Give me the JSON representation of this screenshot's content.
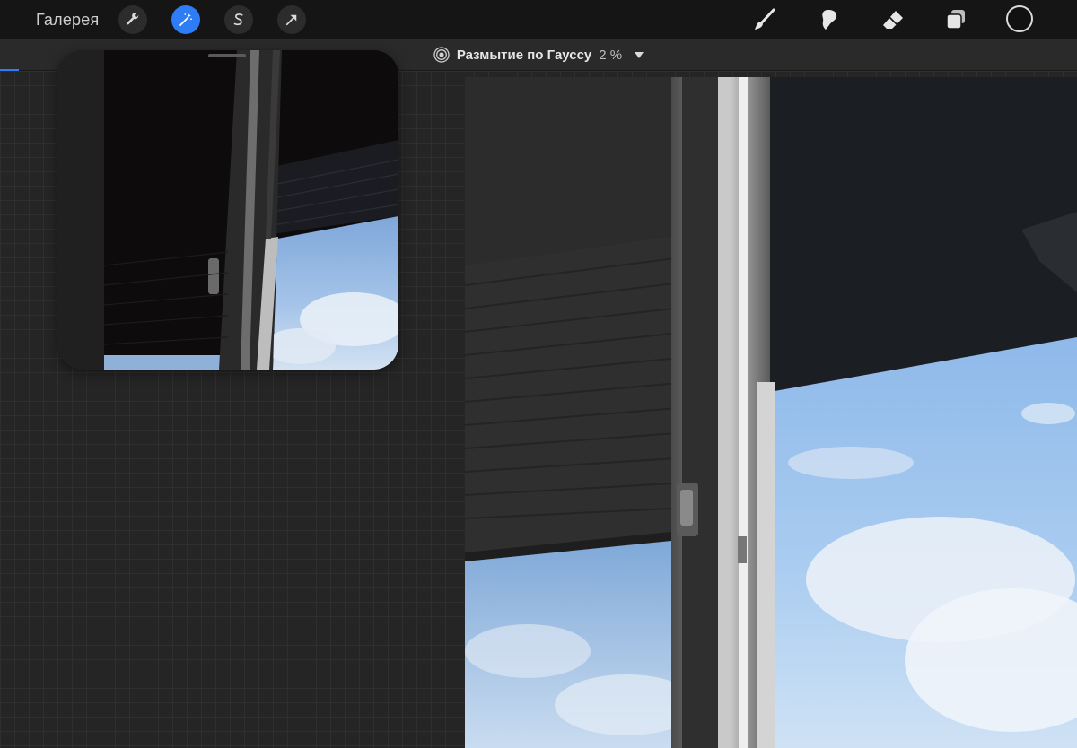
{
  "topbar": {
    "gallery_label": "Галерея",
    "tools_left": [
      {
        "name": "wrench-icon",
        "active": false
      },
      {
        "name": "magic-wand-icon",
        "active": true
      },
      {
        "name": "selection-s-icon",
        "active": false
      },
      {
        "name": "transform-arrow-icon",
        "active": false
      }
    ],
    "tools_right": [
      "brush-icon",
      "smudge-icon",
      "eraser-icon",
      "layers-icon"
    ],
    "color": "#111111",
    "accent": "#2f7df6"
  },
  "adjustment": {
    "filter_name": "Размытие по Гауссу",
    "value": "2 %"
  }
}
